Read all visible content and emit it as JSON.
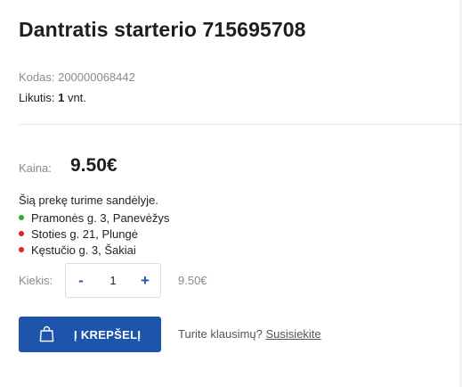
{
  "product": {
    "title": "Dantratis starterio 715695708",
    "code": "Kodas: 200000068442",
    "stock_label": "Likutis:",
    "stock_count": "1",
    "stock_unit": "vnt."
  },
  "price": {
    "label": "Kaina:",
    "value": "9.50€"
  },
  "availability": {
    "text": "Šią prekę turime sandėlyje.",
    "stores": [
      {
        "name": "Pramonės g. 3, Panevėžys",
        "status_color": "#2eaa2e"
      },
      {
        "name": "Stoties g. 21, Plungė",
        "status_color": "#dd2222"
      },
      {
        "name": "Kęstučio g. 3, Šakiai",
        "status_color": "#dd2222"
      }
    ]
  },
  "quantity": {
    "label": "Kiekis:",
    "minus": "-",
    "value": "1",
    "plus": "+",
    "total": "9.50€"
  },
  "cart": {
    "button_label": "Į KREPŠELĮ",
    "icon": "shopping-bag-icon",
    "accent_color": "#1d55ad"
  },
  "contact": {
    "question": "Turite klausimų?",
    "link": "Susisiekite"
  }
}
